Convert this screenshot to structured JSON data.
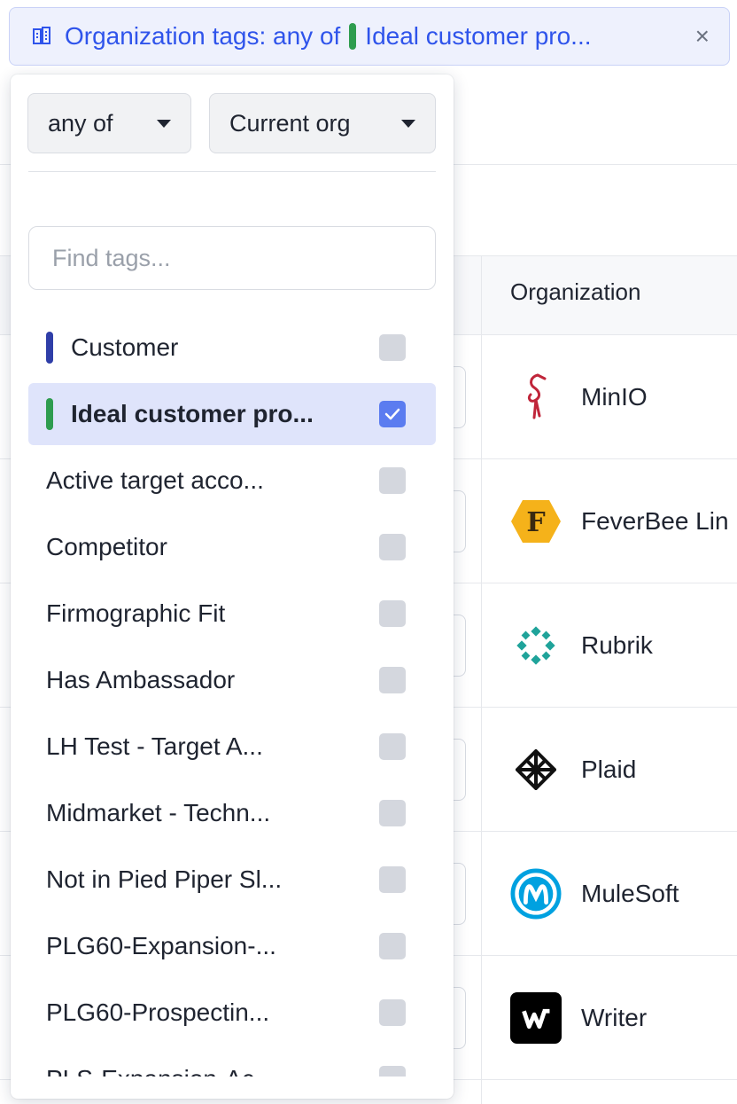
{
  "filter_chip": {
    "prefix": "Organization tags: any of",
    "value": "Ideal customer pro...",
    "close": "×",
    "tag_color": "#2e9c4f"
  },
  "dropdown": {
    "operator_select": "any of",
    "scope_select": "Current org",
    "search_placeholder": "Find tags...",
    "tags": [
      {
        "label": "Customer",
        "color": "#2f3ea8",
        "checked": false
      },
      {
        "label": "Ideal customer pro...",
        "color": "#2e9c4f",
        "checked": true
      },
      {
        "label": "Active target acco...",
        "color": "",
        "checked": false
      },
      {
        "label": "Competitor",
        "color": "",
        "checked": false
      },
      {
        "label": "Firmographic Fit",
        "color": "",
        "checked": false
      },
      {
        "label": "Has Ambassador",
        "color": "",
        "checked": false
      },
      {
        "label": "LH Test - Target A...",
        "color": "",
        "checked": false
      },
      {
        "label": "Midmarket - Techn...",
        "color": "",
        "checked": false
      },
      {
        "label": "Not in Pied Piper Sl...",
        "color": "",
        "checked": false
      },
      {
        "label": "PLG60-Expansion-...",
        "color": "",
        "checked": false
      },
      {
        "label": "PLG60-Prospectin...",
        "color": "",
        "checked": false
      },
      {
        "label": "PLS-Expansion-Ac...",
        "color": "",
        "checked": false
      }
    ]
  },
  "table": {
    "column_header": "Organization",
    "rows": [
      {
        "name": "MinIO",
        "logo": "flamingo-logo"
      },
      {
        "name": "FeverBee Lin",
        "logo": "hexagon-f-logo"
      },
      {
        "name": "Rubrik",
        "logo": "diamond-cluster-logo"
      },
      {
        "name": "Plaid",
        "logo": "lattice-logo"
      },
      {
        "name": "MuleSoft",
        "logo": "m-circle-logo"
      },
      {
        "name": "Writer",
        "logo": "w-square-logo"
      }
    ]
  },
  "colors": {
    "accent": "#2f54eb",
    "checked": "#5b7cf0",
    "selected_row": "#dfe4fb"
  }
}
